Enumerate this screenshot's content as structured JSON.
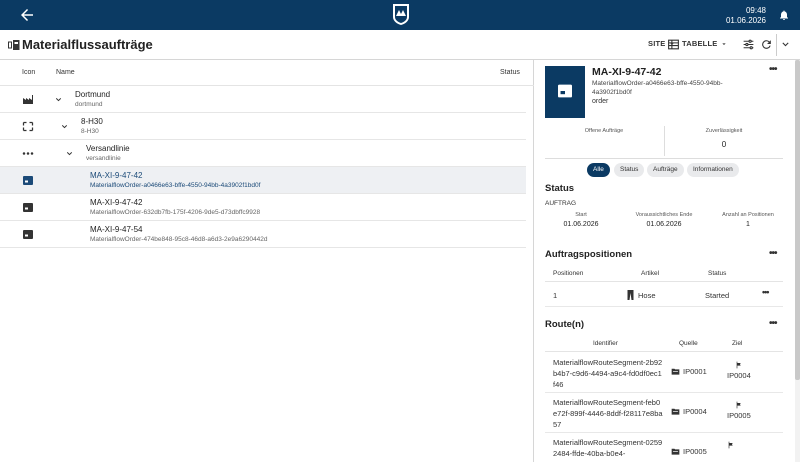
{
  "topbar": {
    "time": "09:48",
    "date": "01.06.2026"
  },
  "titlebar": {
    "title": "Materialflussaufträge",
    "site_label": "SITE",
    "view_label": "TABELLE"
  },
  "table": {
    "columns": {
      "icon": "Icon",
      "name": "Name",
      "status": "Status"
    },
    "rows": [
      {
        "name": "Dortmund",
        "sub": "dortmund"
      },
      {
        "name": "8-H30",
        "sub": "8-H30"
      },
      {
        "name": "Versandlinie",
        "sub": "versandlinie"
      },
      {
        "name": "MA-XI-9-47-42",
        "sub": "MaterialflowOrder-a0466e63-bffe-4550-94bb-4a3902f1bd0f"
      },
      {
        "name": "MA-XI-9-47-42",
        "sub": "MaterialflowOrder-632db7fb-175f-4206-9de5-d73dbffc9928"
      },
      {
        "name": "MA-XI-9-47-54",
        "sub": "MaterialflowOrder-474be848-95c8-46d8-a6d3-2e9a6290442d"
      }
    ]
  },
  "detail": {
    "title": "MA-XI-9-47-42",
    "subtitle": "MaterialflowOrder-a0466e63-bffe-4550-94bb-4a3902f1bd0f",
    "type": "order",
    "kpis": {
      "open_label": "Offene Aufträge",
      "open_value": "",
      "reliability_label": "Zuverlässigkeit",
      "reliability_value": "0"
    },
    "chips": [
      "Alle",
      "Status",
      "Aufträge",
      "Informationen"
    ],
    "status": {
      "heading": "Status",
      "kind": "AUFTRAG",
      "start_label": "Start",
      "start_value": "01.06.2026",
      "end_label": "Voraussichtliches Ende",
      "end_value": "01.06.2026",
      "count_label": "Anzahl an Positionen",
      "count_value": "1"
    },
    "positions": {
      "heading": "Auftragspositionen",
      "columns": [
        "Positionen",
        "Artikel",
        "Status"
      ],
      "rows": [
        {
          "pos": "1",
          "article": "Hose",
          "status": "Started"
        }
      ]
    },
    "routes": {
      "heading": "Route(n)",
      "columns": [
        "Identifier",
        "Quelle",
        "Ziel"
      ],
      "rows": [
        {
          "id": "MaterialflowRouteSegment-2b92b4b7-c9d6-4494-a9c4-fd0df0ec1f46",
          "source": "IP0001",
          "target": "IP0004"
        },
        {
          "id": "MaterialflowRouteSegment-feb0e72f-899f-4446-8ddf-f28117e8ba57",
          "source": "IP0004",
          "target": "IP0005"
        },
        {
          "id": "MaterialflowRouteSegment-02592484-ffde-40ba-b0e4-",
          "source": "IP0005",
          "target": ""
        }
      ]
    }
  }
}
